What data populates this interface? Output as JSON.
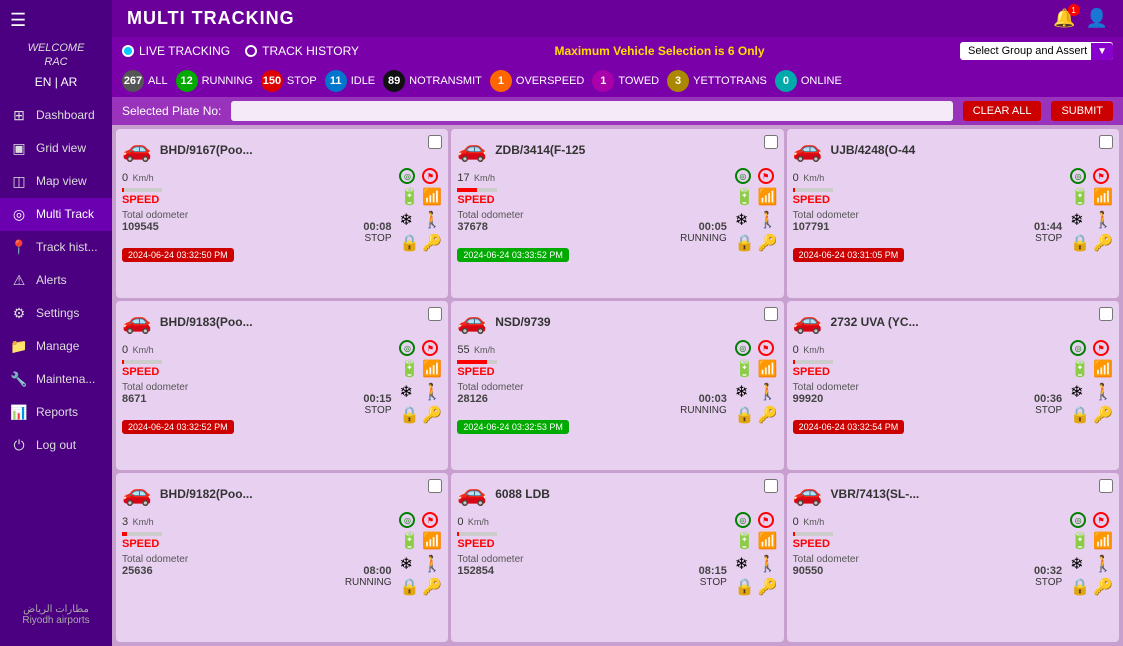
{
  "sidebar": {
    "hamburger": "☰",
    "welcome": "WELCOME\nRAC",
    "lang_en": "EN",
    "lang_sep": "|",
    "lang_ar": "AR",
    "items": [
      {
        "id": "dashboard",
        "label": "Dashboard",
        "icon": "⊞"
      },
      {
        "id": "grid-view",
        "label": "Grid view",
        "icon": "▣"
      },
      {
        "id": "map-view",
        "label": "Map view",
        "icon": "◫"
      },
      {
        "id": "multi-track",
        "label": "Multi Track",
        "icon": "◎",
        "active": true
      },
      {
        "id": "track-hist",
        "label": "Track hist...",
        "icon": "📍"
      },
      {
        "id": "alerts",
        "label": "Alerts",
        "icon": "⚠"
      },
      {
        "id": "settings",
        "label": "Settings",
        "icon": "⚙"
      },
      {
        "id": "manage",
        "label": "Manage",
        "icon": "📁"
      },
      {
        "id": "maintena",
        "label": "Maintena...",
        "icon": "🔧"
      },
      {
        "id": "reports",
        "label": "Reports",
        "icon": "📊"
      },
      {
        "id": "logout",
        "label": "Log out",
        "icon": "⏻"
      }
    ],
    "logo_text": "مطارات الرياض\nRiyodh airports"
  },
  "header": {
    "title": "MULTI TRACKING",
    "bell_icon": "🔔",
    "user_icon": "👤",
    "notification_count": "1"
  },
  "tracking_bar": {
    "live_label": "LIVE TRACKING",
    "history_label": "TRACK HISTORY",
    "warning": "Maximum Vehicle Selection is 6 Only",
    "group_placeholder": "Select Group and Assert"
  },
  "stats": [
    {
      "id": "all",
      "count": "267",
      "label": "ALL",
      "color": "#555555"
    },
    {
      "id": "running",
      "count": "12",
      "label": "RUNNING",
      "color": "#00aa00"
    },
    {
      "id": "stop",
      "count": "150",
      "label": "STOP",
      "color": "#dd0000"
    },
    {
      "id": "idle",
      "count": "11",
      "label": "IDLE",
      "color": "#0077cc"
    },
    {
      "id": "notransmit",
      "count": "89",
      "label": "NOTRANSMIT",
      "color": "#111111"
    },
    {
      "id": "overspeed",
      "count": "1",
      "label": "OVERSPEED",
      "color": "#ff6600"
    },
    {
      "id": "towed",
      "count": "1",
      "label": "TOWED",
      "color": "#aa00aa"
    },
    {
      "id": "yettotrans",
      "count": "3",
      "label": "YETTOTRANS",
      "color": "#aa8800"
    },
    {
      "id": "online",
      "count": "0",
      "label": "ONLINE",
      "color": "#00aaaa"
    }
  ],
  "plate_bar": {
    "label": "Selected Plate No:",
    "clear_label": "CLEAR ALL",
    "submit_label": "SUBMIT"
  },
  "vehicles": [
    {
      "id": "v1",
      "name": "BHD/9167(Poo...",
      "speed": "0",
      "speed_unit": "Km/h",
      "speed_status": "SPEED",
      "odometer_label": "Total odometer",
      "odometer": "109545",
      "duration": "00:08",
      "status": "STOP",
      "timestamp": "2024-06-24 03:32:50 PM",
      "ts_color": "red",
      "car_color": "red"
    },
    {
      "id": "v2",
      "name": "ZDB/3414(F-125",
      "speed": "17",
      "speed_unit": "Km/h",
      "speed_status": "SPEED",
      "odometer_label": "Total odometer",
      "odometer": "37678",
      "duration": "00:05",
      "status": "RUNNING",
      "timestamp": "2024-06-24 03:33:52 PM",
      "ts_color": "green",
      "car_color": "green"
    },
    {
      "id": "v3",
      "name": "UJB/4248(O-44",
      "speed": "0",
      "speed_unit": "Km/h",
      "speed_status": "SPEED",
      "odometer_label": "Total odometer",
      "odometer": "107791",
      "duration": "01:44",
      "status": "STOP",
      "timestamp": "2024-06-24 03:31:05 PM",
      "ts_color": "red",
      "car_color": "red"
    },
    {
      "id": "v4",
      "name": "BHD/9183(Poo...",
      "speed": "0",
      "speed_unit": "Km/h",
      "speed_status": "SPEED",
      "odometer_label": "Total odometer",
      "odometer": "8671",
      "duration": "00:15",
      "status": "STOP",
      "timestamp": "2024-06-24 03:32:52 PM",
      "ts_color": "red",
      "car_color": "red"
    },
    {
      "id": "v5",
      "name": "NSD/9739",
      "speed": "55",
      "speed_unit": "Km/h",
      "speed_status": "SPEED",
      "odometer_label": "Total odometer",
      "odometer": "28126",
      "duration": "00:03",
      "status": "RUNNING",
      "timestamp": "2024-06-24 03:32:53 PM",
      "ts_color": "green",
      "car_color": "green"
    },
    {
      "id": "v6",
      "name": "2732 UVA (YC...",
      "speed": "0",
      "speed_unit": "Km/h",
      "speed_status": "SPEED",
      "odometer_label": "Total odometer",
      "odometer": "99920",
      "duration": "00:36",
      "status": "STOP",
      "timestamp": "2024-06-24 03:32:54 PM",
      "ts_color": "red",
      "car_color": "red"
    },
    {
      "id": "v7",
      "name": "BHD/9182(Poo...",
      "speed": "3",
      "speed_unit": "Km/h",
      "speed_status": "SPEED",
      "odometer_label": "Total odometer",
      "odometer": "25636",
      "duration": "08:00",
      "status": "RUNNING",
      "timestamp": "",
      "ts_color": "none",
      "car_color": "green"
    },
    {
      "id": "v8",
      "name": "6088 LDB",
      "speed": "0",
      "speed_unit": "Km/h",
      "speed_status": "SPEED",
      "odometer_label": "Total odometer",
      "odometer": "152854",
      "duration": "08:15",
      "status": "STOP",
      "timestamp": "",
      "ts_color": "none",
      "car_color": "red"
    },
    {
      "id": "v9",
      "name": "VBR/7413(SL-...",
      "speed": "0",
      "speed_unit": "Km/h",
      "speed_status": "SPEED",
      "odometer_label": "Total odometer",
      "odometer": "90550",
      "duration": "00:32",
      "status": "STOP",
      "timestamp": "",
      "ts_color": "none",
      "car_color": "red"
    }
  ]
}
